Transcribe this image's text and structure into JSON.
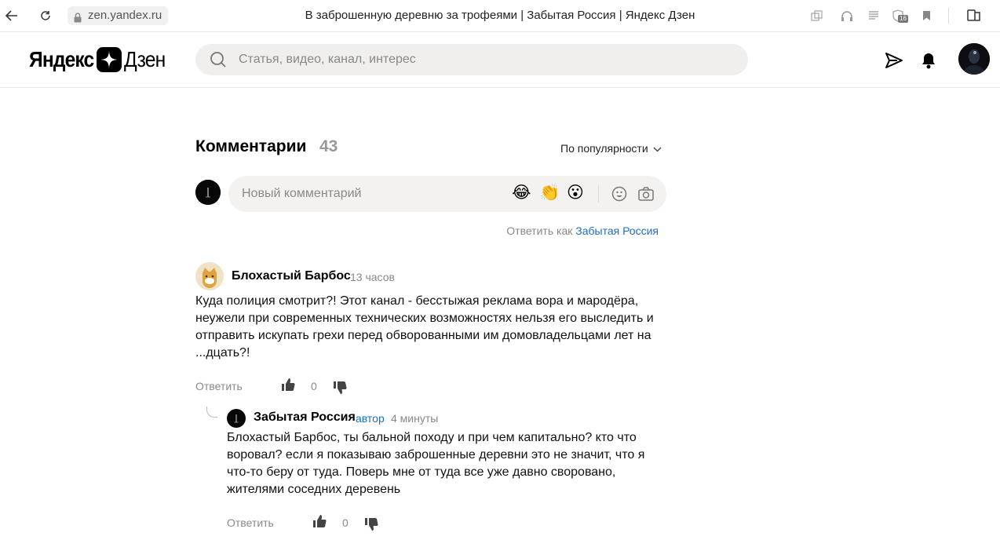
{
  "browser": {
    "url": "zen.yandex.ru",
    "tab_title": "В заброшенную деревню за трофеями | Забытая Россия | Яндекс Дзен",
    "badge_count": "16"
  },
  "header": {
    "logo_left": "Яндекс",
    "logo_right": "Дзен",
    "search_placeholder": "Статья, видео, канал, интерес"
  },
  "comments": {
    "title": "Комментарии",
    "count": "43",
    "sort_label": "По популярности",
    "new_comment_placeholder": "Новый комментарий",
    "emojis": [
      "😂",
      "👏",
      "😮"
    ],
    "reply_as_prefix": "Ответить как",
    "reply_as_name": "Забытая Россия",
    "items": [
      {
        "author": "Блохастый Барбос",
        "time": "13 часов",
        "text_lines": [
          "Куда полиция смотрит?! Этот канал - бесстыжая реклама вора и мародёра,",
          "неужели при современных технических возможностях нельзя его выследить и",
          "отправить искупать грехи перед обворованными им домовладельцами лет на",
          "...дцать?!"
        ],
        "reply_label": "Ответить",
        "likes": "0"
      },
      {
        "author": "Забытая Россия",
        "role": "автор",
        "time": "4 минуты",
        "text_lines": [
          "Блохастый Барбос, ты бальной походу и при чем капитально? кто что",
          "воровал? если я показываю заброшенные деревни это не значит, что я",
          "что-то беру от туда. Поверь мне от туда все уже давно своровано,",
          "жителями соседних деревень"
        ],
        "reply_label": "Ответить",
        "likes": "0"
      }
    ]
  }
}
